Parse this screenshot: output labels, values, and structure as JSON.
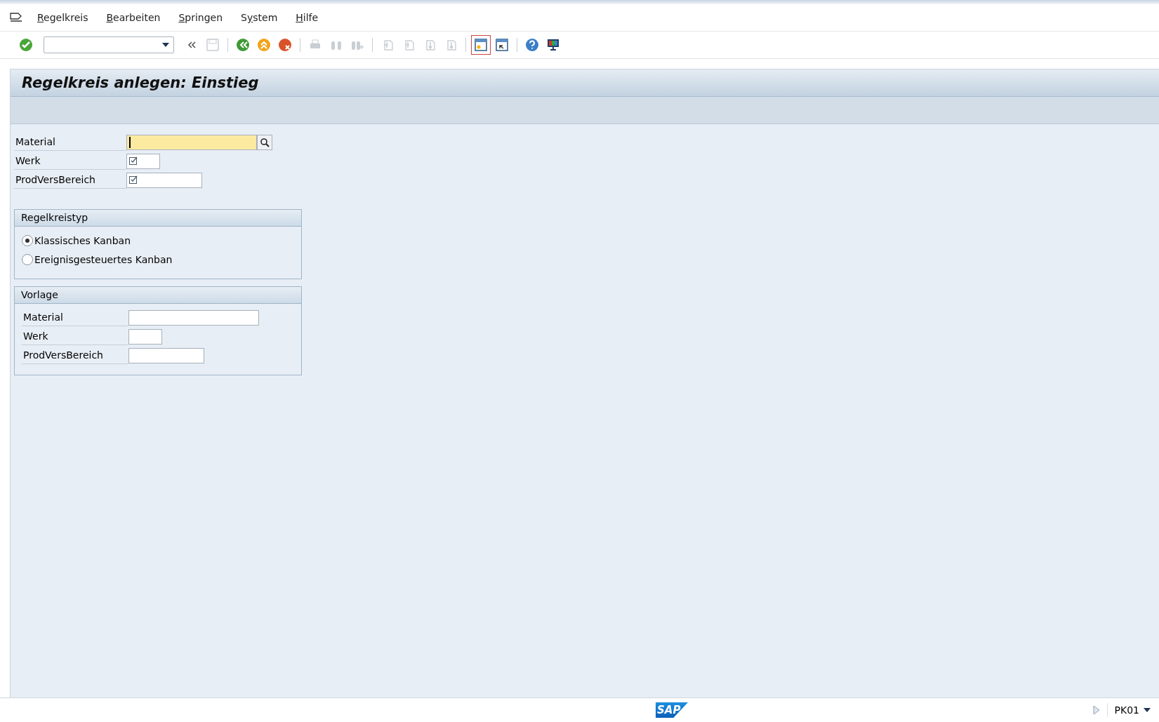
{
  "menu_bar": [
    {
      "key": "R",
      "after": "egelkreis"
    },
    {
      "key": "B",
      "after": "earbeiten"
    },
    {
      "key": "S",
      "after": "pringen"
    },
    {
      "before": "S",
      "key": "y",
      "after": "stem"
    },
    {
      "key": "H",
      "after": "ilfe"
    }
  ],
  "toolbar": [
    {
      "kind": "enter",
      "disabled": false
    },
    {
      "kind": "command_field"
    },
    {
      "kind": "collapse",
      "disabled": false
    },
    {
      "kind": "save",
      "disabled": true
    },
    {
      "kind": "separator"
    },
    {
      "kind": "back",
      "disabled": false
    },
    {
      "kind": "exit",
      "disabled": false
    },
    {
      "kind": "cancel",
      "disabled": false
    },
    {
      "kind": "separator"
    },
    {
      "kind": "print",
      "disabled": true
    },
    {
      "kind": "find",
      "disabled": true
    },
    {
      "kind": "find_next",
      "disabled": true
    },
    {
      "kind": "separator"
    },
    {
      "kind": "first_page",
      "disabled": true
    },
    {
      "kind": "prev_page",
      "disabled": true
    },
    {
      "kind": "next_page",
      "disabled": true
    },
    {
      "kind": "last_page",
      "disabled": true
    },
    {
      "kind": "separator"
    },
    {
      "kind": "new_session",
      "disabled": false
    },
    {
      "kind": "shortcut",
      "disabled": false
    },
    {
      "kind": "separator"
    },
    {
      "kind": "help",
      "disabled": false
    },
    {
      "kind": "layout",
      "disabled": false
    }
  ],
  "title": "Regelkreis anlegen: Einstieg",
  "fields": [
    {
      "label": "Material",
      "focused": true,
      "required": false,
      "search_help": true
    },
    {
      "label": "Werk",
      "focused": false,
      "required": true,
      "search_help": false
    },
    {
      "label": "ProdVersBereich",
      "focused": false,
      "required": true,
      "search_help": false
    }
  ],
  "groups": [
    {
      "title": "Regelkreistyp",
      "kind": "radio",
      "options": [
        {
          "label": "Klassisches Kanban",
          "selected": true
        },
        {
          "label": "Ereignisgesteuertes Kanban",
          "selected": false
        }
      ]
    },
    {
      "title": "Vorlage",
      "kind": "fields",
      "fields": [
        {
          "label": "Material",
          "focused": false,
          "required": false,
          "search_help": false
        },
        {
          "label": "Werk",
          "focused": false,
          "required": false,
          "search_help": false
        },
        {
          "label": "ProdVersBereich",
          "focused": false,
          "required": false,
          "search_help": false
        }
      ]
    }
  ],
  "status_bar": {
    "logo": "SAP",
    "transaction": "PK01"
  }
}
